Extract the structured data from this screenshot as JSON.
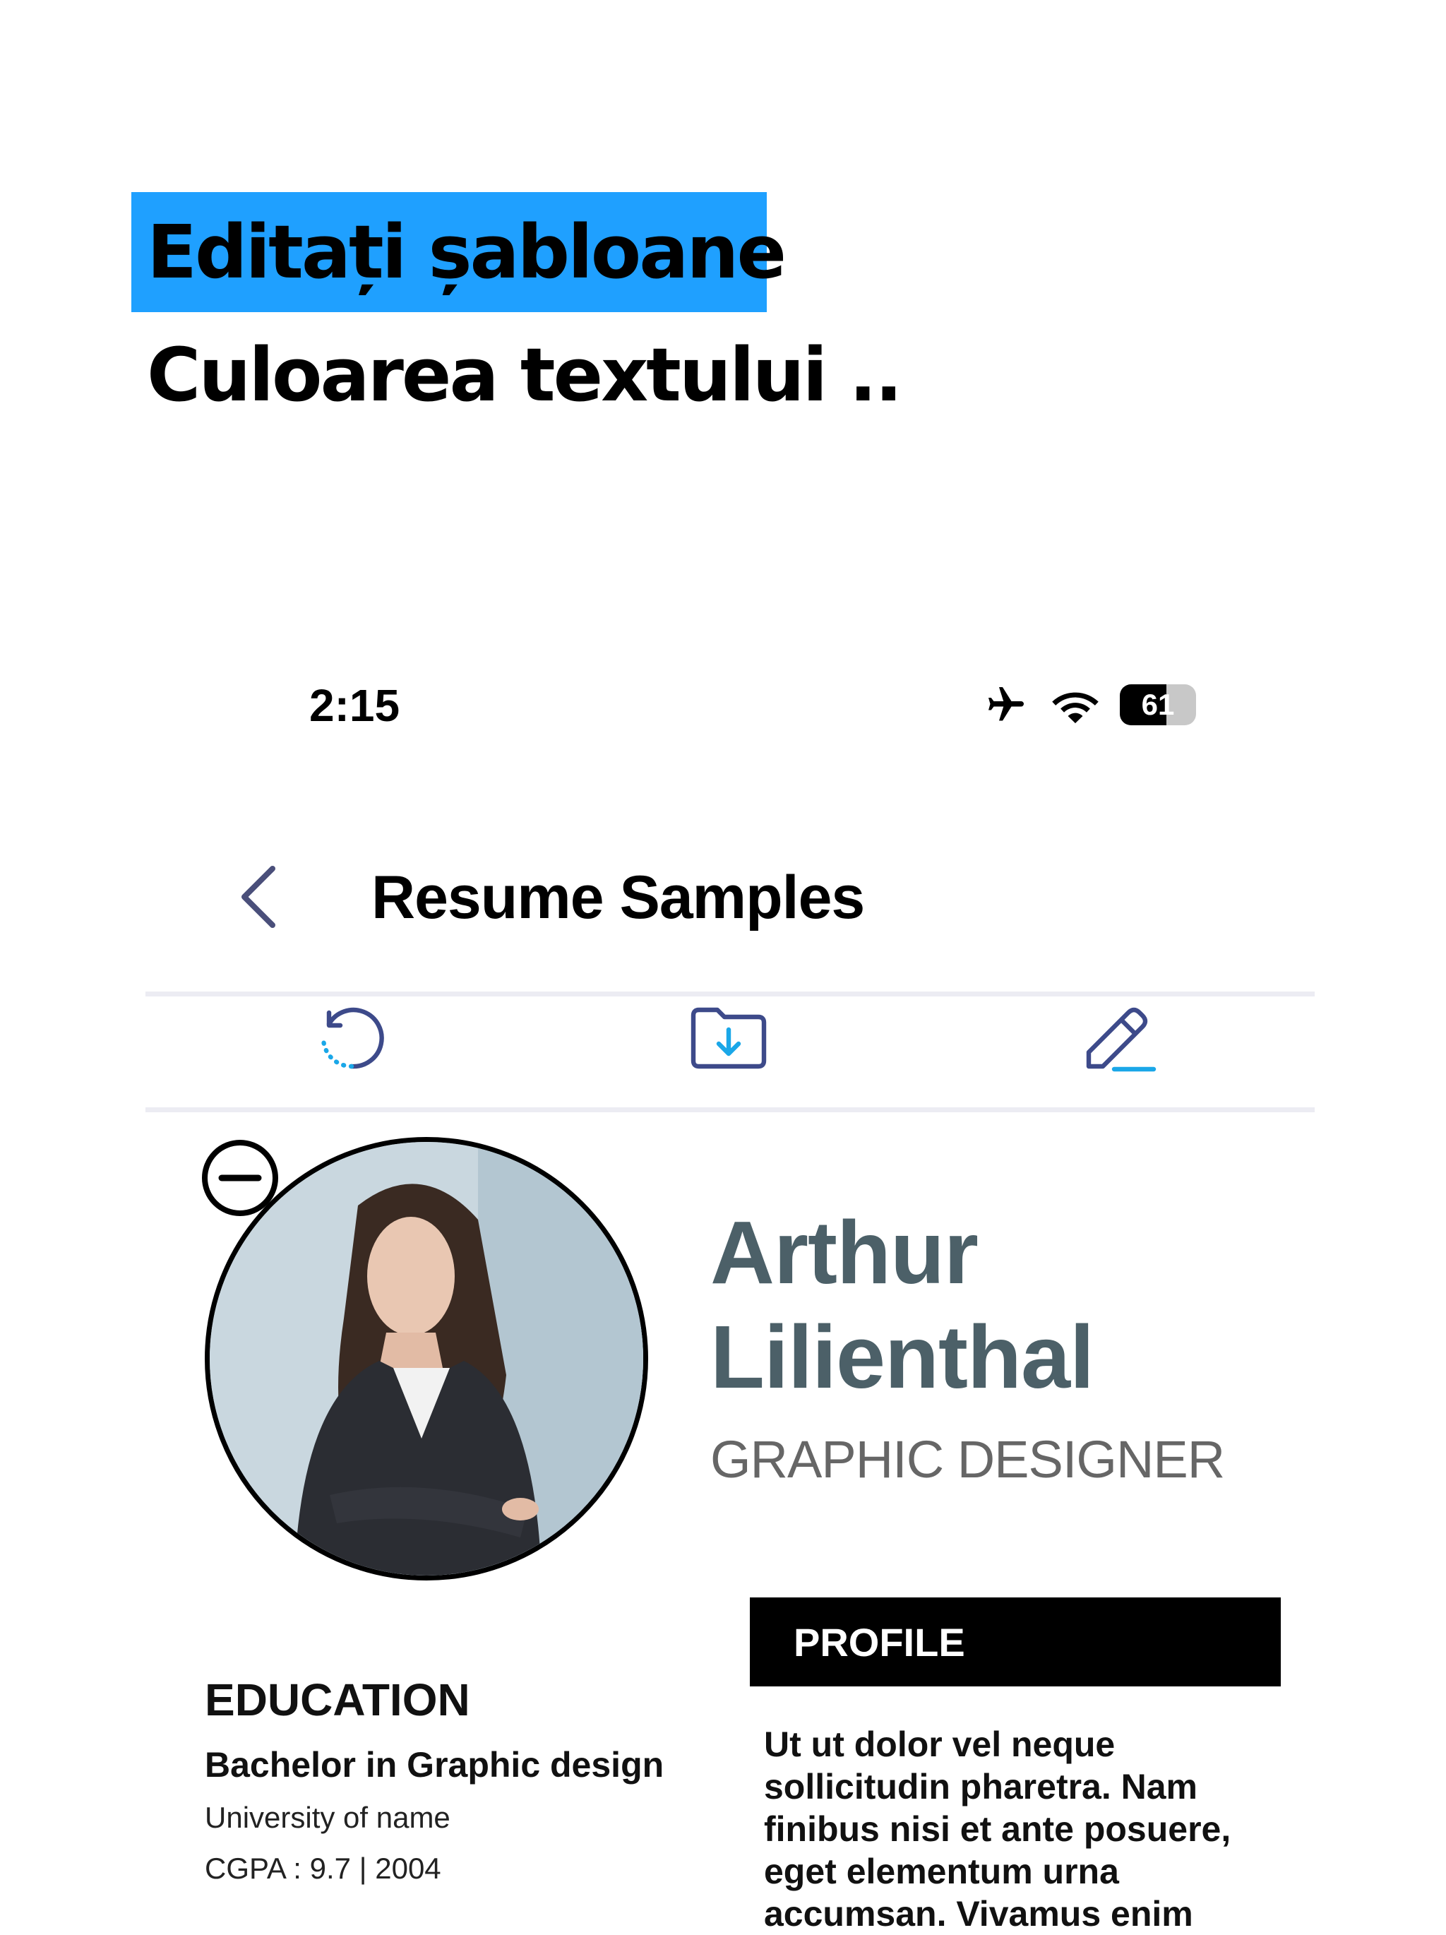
{
  "promo": {
    "title": "Editați șabloane",
    "subtitle": "Culoarea textului .."
  },
  "status_bar": {
    "time": "2:15",
    "battery": "61",
    "battery_level": 0.61,
    "icons": [
      "airplane-icon",
      "wifi-icon",
      "battery-icon"
    ]
  },
  "nav": {
    "title": "Resume Samples"
  },
  "toolbar": {
    "icons": [
      "reset-icon",
      "download-folder-icon",
      "edit-pencil-icon"
    ]
  },
  "resume": {
    "name": "Arthur Lilienthal",
    "role": "GRAPHIC DESIGNER",
    "profile_header": "PROFILE",
    "profile_text": "Ut ut dolor vel neque sollicitudin pharetra. Nam finibus nisi et ante posuere, eget elementum urna accumsan. Vivamus enim",
    "education": {
      "header": "EDUCATION",
      "degree": "Bachelor in Graphic design",
      "school": "University of name",
      "cgpa": "CGPA : 9.7 | 2004"
    }
  },
  "colors": {
    "highlight": "#1fa0ff",
    "icon_navy": "#3d4a8a",
    "icon_accent": "#1aa7e8",
    "name_color": "#4c6068"
  }
}
